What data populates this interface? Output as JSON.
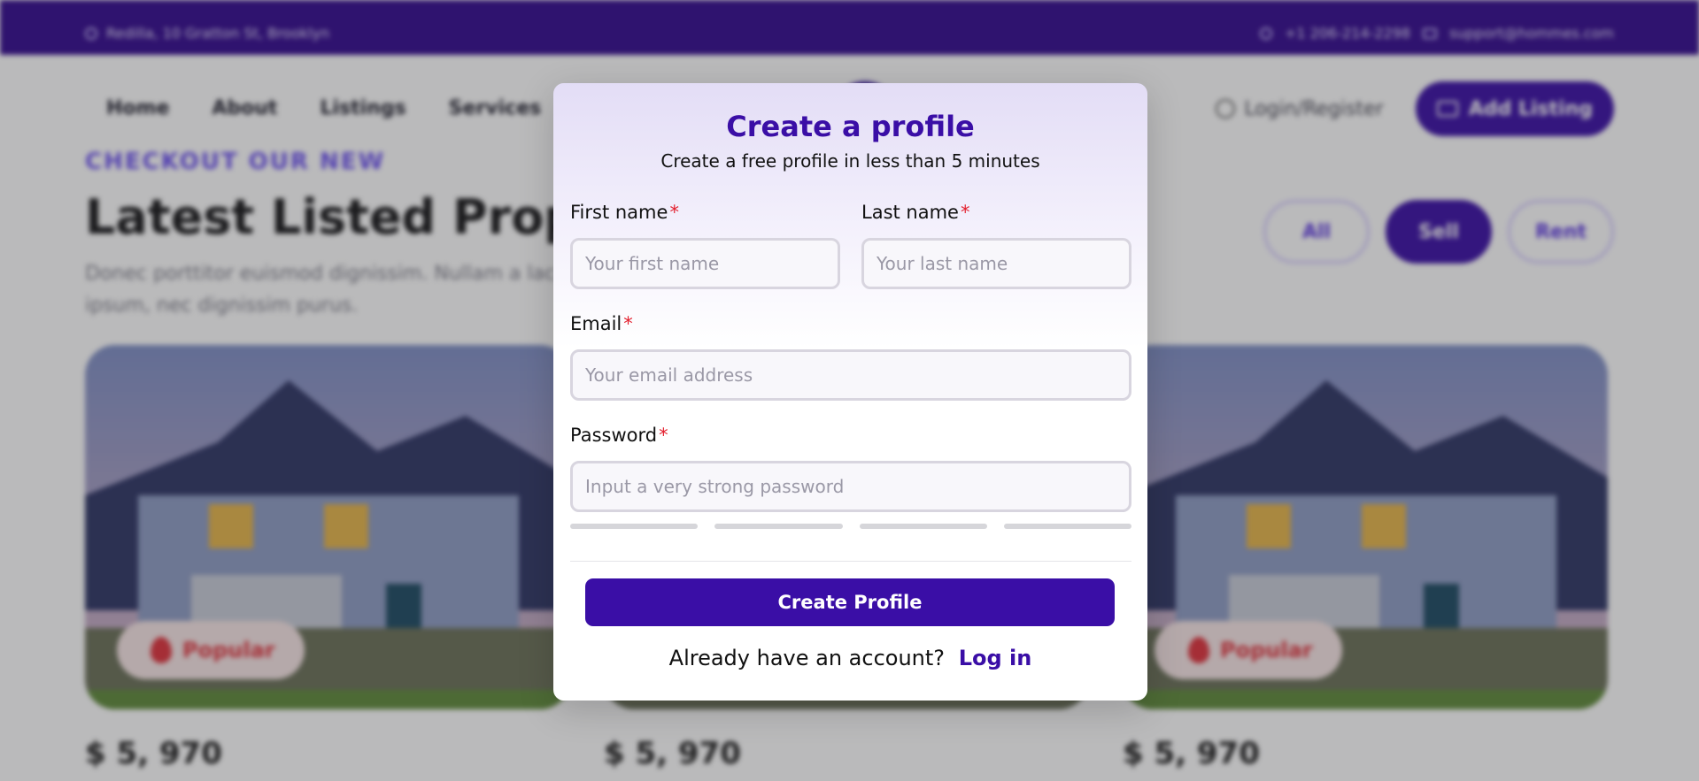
{
  "topbar": {
    "address": "Redilla, 10 Gratton St, Brooklyn",
    "phone": "+1 206-214-2298",
    "email": "support@hommes.com"
  },
  "nav": {
    "links": [
      "Home",
      "About",
      "Listings",
      "Services"
    ],
    "login_register": "Login/Register",
    "add_listing": "Add Listing"
  },
  "section": {
    "eyebrow": "CHECKOUT OUR NEW",
    "headline": "Latest Listed Properties",
    "subtext": "Donec porttitor euismod dignissim. Nullam a lacinia ipsum, nec dignissim purus."
  },
  "filters": [
    "All",
    "Sell",
    "Rent"
  ],
  "cards": [
    {
      "badge": "Popular",
      "price": "$ 5, 970"
    },
    {
      "badge": "",
      "price": "$ 5, 970"
    },
    {
      "badge": "Popular",
      "price": "$ 5, 970"
    }
  ],
  "modal": {
    "title": "Create a profile",
    "subtitle": "Create a free profile in less than 5 minutes",
    "required_mark": "*",
    "first_name": {
      "label": "First name",
      "placeholder": "Your first name"
    },
    "last_name": {
      "label": "Last name",
      "placeholder": "Your last name"
    },
    "email": {
      "label": "Email",
      "placeholder": "Your email address"
    },
    "password": {
      "label": "Password",
      "placeholder": "Input a very strong password"
    },
    "submit": "Create Profile",
    "have_account": "Already have an account?",
    "login_link": "Log in"
  },
  "colors": {
    "brand": "#3a0ea6",
    "required": "#e3202e",
    "popular": "#e0323c"
  }
}
